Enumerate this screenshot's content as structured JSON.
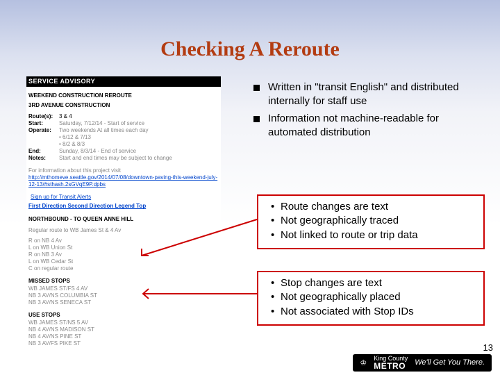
{
  "title": "Checking A Reroute",
  "top_bullets": [
    "Written in \"transit English\" and distributed internally for staff use",
    "Information not machine-readable for automated distribution"
  ],
  "callout1": [
    "Route changes are text",
    "Not geographically traced",
    "Not linked to route or trip data"
  ],
  "callout2": [
    "Stop changes are text",
    "Not geographically placed",
    "Not associated with Stop IDs"
  ],
  "doc": {
    "header": "SERVICE ADVISORY",
    "sub1": "WEEKEND CONSTRUCTION REROUTE",
    "sub2": "3RD AVENUE CONSTRUCTION",
    "routes_lbl": "Route(s):",
    "routes": "3 & 4",
    "start_lbl": "Start:",
    "start": "Saturday, 7/12/14 - Start of service",
    "operate_lbl": "Operate:",
    "operate_a": "Two weekends  At all times each day",
    "operate_b": "•  6/12 & 7/13",
    "operate_c": "•  8/2 & 8/3",
    "end_lbl": "End:",
    "end": "Sunday, 8/3/14 - End of service",
    "notes_lbl": "Notes:",
    "notes": "Start and end times may be subject to change",
    "info": "For information about this project visit",
    "link": "http://mthomeve.seattle.gov/2014/07/08/downtown-paving-this-weekend-july-12-13/#sthash.2sGVqE9P.dpbs",
    "signup": "Sign up for Transit Alerts",
    "nav": "First Direction  Second Direction  Legend   Top",
    "nb_hdr": "NORTHBOUND - TO QUEEN ANNE HILL",
    "reg": "Regular route to WB James St & 4 Av",
    "turns": [
      "R on NB 4 Av",
      "L on WB Union St",
      "R on NB 3 Av",
      "L on WB Cedar St",
      "C on regular route"
    ],
    "missed_hdr": "MISSED STOPS",
    "missed": [
      "WB JAMES ST/FS 4 AV",
      "NB 3 AV/NS COLUMBIA ST",
      "NB 3 AV/NS SENECA ST"
    ],
    "use_hdr": "USE STOPS",
    "use": [
      "WB JAMES ST/NS 5 AV",
      "NB 4 AV/NS MADISON ST",
      "NB 4 AV/NS PINE ST",
      "NB 3 AV/FS PIKE ST"
    ]
  },
  "footer": {
    "county": "King County",
    "metro": "METRO",
    "slogan": "We'll Get You There."
  },
  "page_number": "13"
}
